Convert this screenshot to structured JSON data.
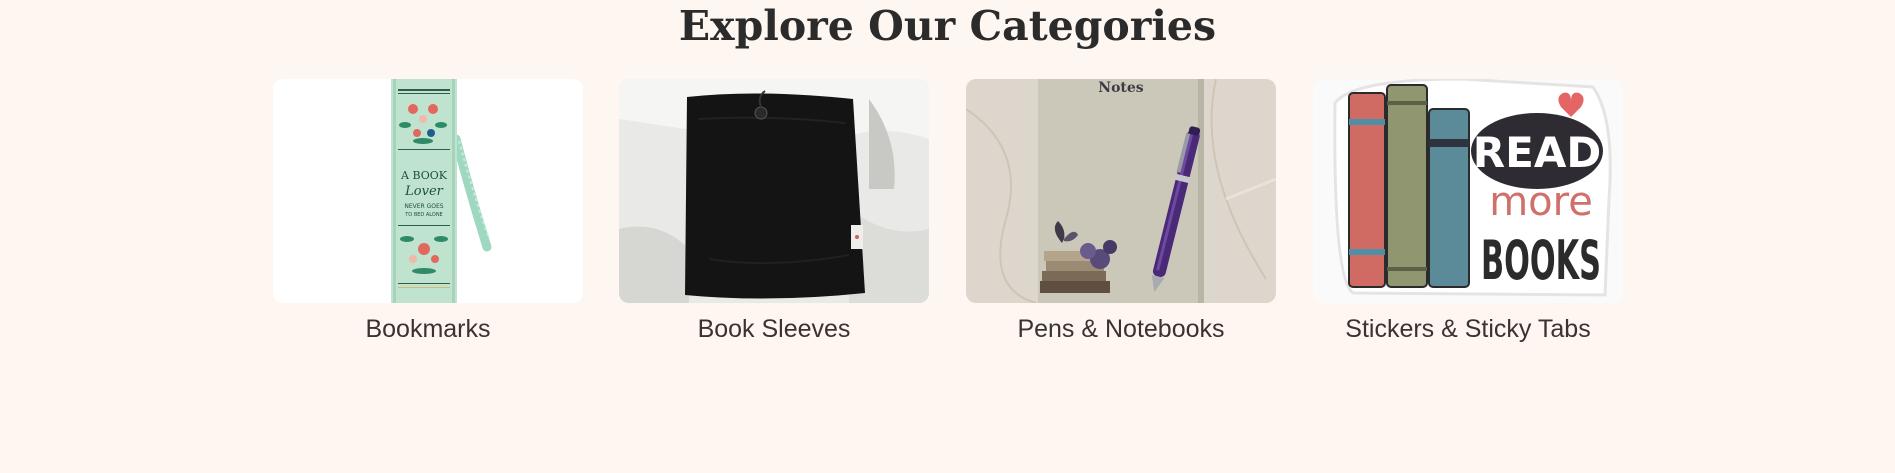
{
  "section": {
    "title": "Explore Our Categories"
  },
  "categories": [
    {
      "label": "Bookmarks",
      "image_text": [
        "A BOOK",
        "Lover",
        "NEVER GOES",
        "TO BED ALONE"
      ]
    },
    {
      "label": "Book Sleeves"
    },
    {
      "label": "Pens & Notebooks",
      "image_text": [
        "Notes"
      ]
    },
    {
      "label": "Stickers & Sticky Tabs",
      "image_text": [
        "READ",
        "more",
        "BOOKS"
      ]
    }
  ],
  "colors": {
    "background": "#fdf6f1",
    "heading": "#2b2b2b",
    "label": "#3b3330"
  }
}
